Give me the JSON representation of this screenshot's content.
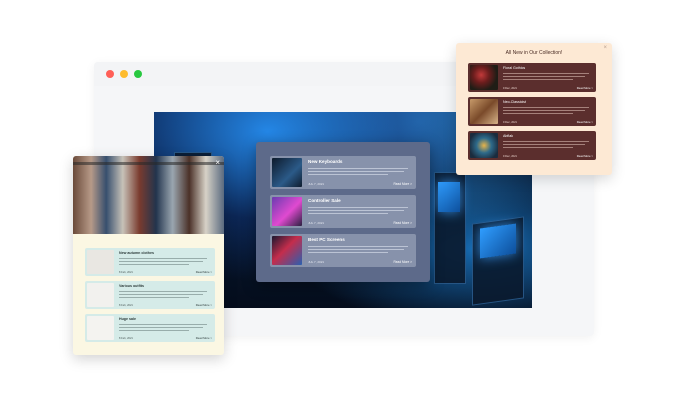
{
  "colors": {
    "center_popup_bg": "#5d6a8a",
    "center_item_bg": "#8792ab",
    "left_popup_bg": "#fbf7e3",
    "left_item_bg": "#d5ebe8",
    "right_popup_bg": "#fde9d4",
    "right_item_bg": "#5b2e2d"
  },
  "center_popup": {
    "items": [
      {
        "title": "New Keyboards",
        "date": "JUL 7, 2021",
        "more": "Read More >"
      },
      {
        "title": "Controller Sale",
        "date": "JUL 7, 2021",
        "more": "Read More >"
      },
      {
        "title": "Best PC Screens",
        "date": "JUL 7, 2021",
        "more": "Read More >"
      }
    ]
  },
  "left_popup": {
    "close_icon": "×",
    "items": [
      {
        "title": "New autumn clothes",
        "date": "8 Feb, 2021",
        "more": "Read More >"
      },
      {
        "title": "Various outfits",
        "date": "8 Feb, 2021",
        "more": "Read More >"
      },
      {
        "title": "Huge sale",
        "date": "8 Feb, 2021",
        "more": "Read More >"
      }
    ]
  },
  "right_popup": {
    "title": "All New in Our Collection!",
    "close_icon": "×",
    "items": [
      {
        "title": "Floral Gothics",
        "date": "9 Dec, 2021",
        "more": "Read More >"
      },
      {
        "title": "Neo-Classicist",
        "date": "9 Dec, 2021",
        "more": "Read More >"
      },
      {
        "title": "Abflak",
        "date": "9 Dec, 2021",
        "more": "Read More >"
      }
    ]
  }
}
